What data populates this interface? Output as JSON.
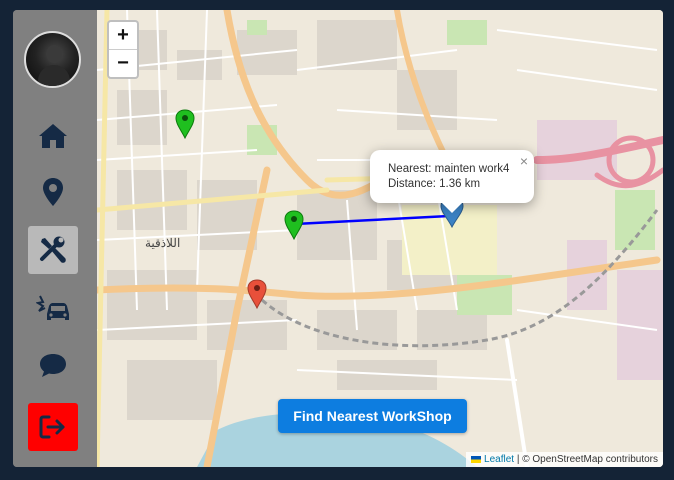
{
  "sidebar": {
    "items": [
      {
        "name": "home-icon"
      },
      {
        "name": "map-marker-icon"
      },
      {
        "name": "tools-icon",
        "active": true
      },
      {
        "name": "car-crash-icon"
      },
      {
        "name": "chat-bubble-icon"
      },
      {
        "name": "logout-icon"
      }
    ],
    "active_bg": "#b9b9b9",
    "logout_color": "#ff0000"
  },
  "map": {
    "zoom_in_label": "+",
    "zoom_out_label": "−",
    "popup": {
      "line1": "Nearest: mainten work4",
      "line2": "Distance: 1.36 km",
      "close_label": "×"
    },
    "find_button_label": "Find Nearest WorkShop",
    "attribution": {
      "leaflet": "Leaflet",
      "separator": "|",
      "rest": "© OpenStreetMap contributors"
    },
    "place_label": "اللاذقية",
    "route_color": "#0000ff",
    "button_color": "#0d7de0"
  }
}
